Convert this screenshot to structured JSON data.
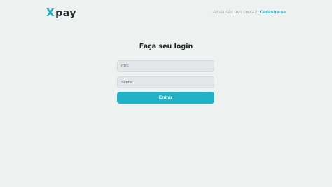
{
  "header": {
    "logo_x": "X",
    "logo_rest": "pay",
    "signup_prompt": "Ainda não tem conta?",
    "signup_link": "Cadastre-se"
  },
  "login": {
    "title": "Faça seu login",
    "cpf_placeholder": "CPF",
    "cpf_value": "",
    "password_placeholder": "Senha",
    "password_value": "",
    "submit_label": "Entrar"
  },
  "colors": {
    "background": "#edf2f1",
    "accent": "#21b2c8",
    "text_dark": "#1f272b",
    "input_bg": "#e4e7ea"
  }
}
